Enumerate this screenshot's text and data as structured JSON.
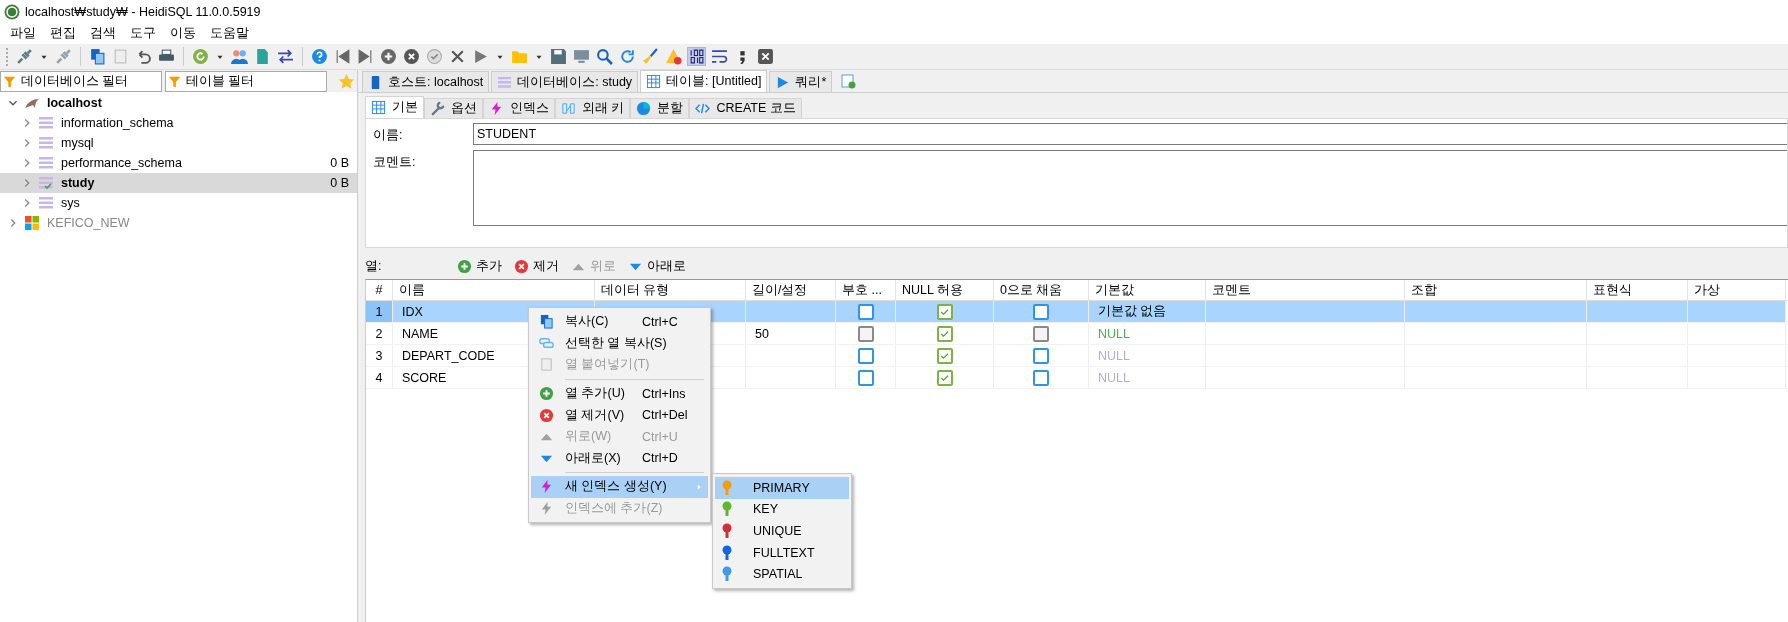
{
  "window": {
    "title": "localhost₩study₩ - HeidiSQL 11.0.0.5919"
  },
  "menu": [
    "파일",
    "편집",
    "검색",
    "도구",
    "이동",
    "도움말"
  ],
  "filters": {
    "database": {
      "placeholder": "데이터베이스 필터"
    },
    "table": {
      "placeholder": "테이블 필터"
    }
  },
  "tree": [
    {
      "label": "localhost",
      "expanded": true,
      "selected": false,
      "disabled": false,
      "children": [
        {
          "label": "information_schema",
          "expanded": false,
          "selected": false
        },
        {
          "label": "mysql",
          "expanded": false,
          "selected": false
        },
        {
          "label": "performance_schema",
          "expanded": false,
          "selected": false,
          "size": "0 B"
        },
        {
          "label": "study",
          "expanded": false,
          "selected": true,
          "size": "0 B"
        },
        {
          "label": "sys",
          "expanded": false,
          "selected": false
        }
      ]
    },
    {
      "label": "KEFICO_NEW",
      "expanded": false,
      "selected": false,
      "disabled": true
    }
  ],
  "main_tabs": [
    {
      "label": "호스트: localhost",
      "selected": false
    },
    {
      "label": "데이터베이스: study",
      "selected": false
    },
    {
      "label": "테이블: [Untitled]",
      "selected": true
    },
    {
      "label": "쿼리*",
      "selected": false
    }
  ],
  "table_editor": {
    "tabs": [
      {
        "label": "기본",
        "selected": true
      },
      {
        "label": "옵션",
        "selected": false
      },
      {
        "label": "인덱스",
        "selected": false
      },
      {
        "label": "외래 키",
        "selected": false
      },
      {
        "label": "분할",
        "selected": false
      },
      {
        "label": "CREATE 코드",
        "selected": false
      }
    ],
    "name_label": "이름:",
    "name_value": "STUDENT",
    "comment_label": "코멘트:"
  },
  "columns_toolbar": {
    "label": "열:",
    "buttons": [
      {
        "label": "추가",
        "disabled": false
      },
      {
        "label": "제거",
        "disabled": false
      },
      {
        "label": "위로",
        "disabled": true
      },
      {
        "label": "아래로",
        "disabled": false
      }
    ]
  },
  "grid": {
    "columns": [
      "#",
      "이름",
      "데이터 유형",
      "길이/설정",
      "부호 ...",
      "NULL 허용",
      "0으로 채움",
      "기본값",
      "코멘트",
      "조합",
      "표현식",
      "가상"
    ],
    "rows": [
      {
        "number": "1",
        "name": "IDX",
        "selected": true,
        "unsigned": {
          "checked": false,
          "disabled": false
        },
        "allow_null": {
          "checked": true,
          "disabled": false
        },
        "zerofill": {
          "checked": false,
          "disabled": false
        },
        "default": {
          "text": "기본값 없음",
          "kind": "text"
        }
      },
      {
        "number": "2",
        "name": "NAME",
        "length": "50",
        "selected": false,
        "unsigned": {
          "checked": false,
          "disabled": true
        },
        "allow_null": {
          "checked": true,
          "disabled": false
        },
        "zerofill": {
          "checked": false,
          "disabled": true
        },
        "default": {
          "text": "NULL",
          "kind": "null"
        }
      },
      {
        "number": "3",
        "name": "DEPART_CODE",
        "selected": false,
        "unsigned": {
          "checked": false,
          "disabled": false
        },
        "allow_null": {
          "checked": true,
          "disabled": false
        },
        "zerofill": {
          "checked": false,
          "disabled": false
        },
        "default": {
          "text": "NULL",
          "kind": "null-muted"
        }
      },
      {
        "number": "4",
        "name": "SCORE",
        "selected": false,
        "unsigned": {
          "checked": false,
          "disabled": false
        },
        "allow_null": {
          "checked": true,
          "disabled": false
        },
        "zerofill": {
          "checked": false,
          "disabled": false
        },
        "default": {
          "text": "NULL",
          "kind": "null-muted"
        }
      }
    ]
  },
  "context_menu": {
    "items": [
      {
        "kind": "item",
        "label": "복사(C)",
        "shortcut": "Ctrl+C",
        "disabled": false,
        "selected": false
      },
      {
        "kind": "item",
        "label": "선택한 열 복사(S)",
        "disabled": false,
        "selected": false
      },
      {
        "kind": "item",
        "label": "열 붙여넣기(T)",
        "disabled": true,
        "selected": false
      },
      {
        "kind": "separator"
      },
      {
        "kind": "item",
        "label": "열 추가(U)",
        "shortcut": "Ctrl+Ins",
        "disabled": false,
        "selected": false
      },
      {
        "kind": "item",
        "label": "열 제거(V)",
        "shortcut": "Ctrl+Del",
        "disabled": false,
        "selected": false
      },
      {
        "kind": "item",
        "label": "위로(W)",
        "shortcut": "Ctrl+U",
        "disabled": true,
        "selected": false
      },
      {
        "kind": "item",
        "label": "아래로(X)",
        "shortcut": "Ctrl+D",
        "disabled": false,
        "selected": false
      },
      {
        "kind": "separator"
      },
      {
        "kind": "submenu",
        "label": "새 인덱스 생성(Y)",
        "disabled": false,
        "selected": true
      },
      {
        "kind": "item",
        "label": "인덱스에 추가(Z)",
        "disabled": true,
        "selected": false
      }
    ]
  },
  "submenu": {
    "items": [
      {
        "label": "PRIMARY",
        "color": "#f39c12",
        "selected": true
      },
      {
        "label": "KEY",
        "color": "#5cb82e",
        "selected": false
      },
      {
        "label": "UNIQUE",
        "color": "#d32f3a",
        "selected": false
      },
      {
        "label": "FULLTEXT",
        "color": "#1565e0",
        "selected": false
      },
      {
        "label": "SPATIAL",
        "color": "#3d9be9",
        "selected": false
      }
    ]
  }
}
